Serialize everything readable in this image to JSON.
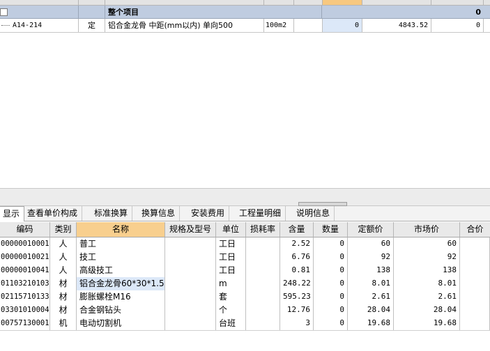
{
  "top_grid": {
    "total_row": {
      "name": "整个项目",
      "amount": "0"
    },
    "item_row": {
      "code": "A14-214",
      "type": "定",
      "name": "铝合金龙骨 中距(mm以内) 单向500",
      "unit": "100m2",
      "quantity": "0",
      "price": "4843.52",
      "total": "0"
    }
  },
  "tabs": [
    {
      "label": "显示"
    },
    {
      "label": "查看单价构成"
    },
    {
      "label": "标准换算"
    },
    {
      "label": "换算信息"
    },
    {
      "label": "安装费用"
    },
    {
      "label": "工程量明细"
    },
    {
      "label": "说明信息"
    }
  ],
  "bottom_grid": {
    "headers": [
      "编码",
      "类别",
      "名称",
      "规格及型号",
      "单位",
      "损耗率",
      "含量",
      "数量",
      "定额价",
      "市场价",
      "合价"
    ],
    "rows": [
      {
        "code": "00000010001",
        "type": "人",
        "name": "普工",
        "spec": "",
        "unit": "工日",
        "loss": "",
        "content": "2.52",
        "qty": "0",
        "quota_price": "60",
        "market_price": "60",
        "total": ""
      },
      {
        "code": "00000010021",
        "type": "人",
        "name": "技工",
        "spec": "",
        "unit": "工日",
        "loss": "",
        "content": "6.76",
        "qty": "0",
        "quota_price": "92",
        "market_price": "92",
        "total": ""
      },
      {
        "code": "00000010041",
        "type": "人",
        "name": "高级技工",
        "spec": "",
        "unit": "工日",
        "loss": "",
        "content": "0.81",
        "qty": "0",
        "quota_price": "138",
        "market_price": "138",
        "total": ""
      },
      {
        "code": "01103210103",
        "type": "材",
        "name": "铝合金龙骨60*30*1.5",
        "spec": "",
        "unit": "m",
        "loss": "",
        "content": "248.22",
        "qty": "0",
        "quota_price": "8.01",
        "market_price": "8.01",
        "total": ""
      },
      {
        "code": "02115710133",
        "type": "材",
        "name": "膨胀螺栓M16",
        "spec": "",
        "unit": "套",
        "loss": "",
        "content": "595.23",
        "qty": "0",
        "quota_price": "2.61",
        "market_price": "2.61",
        "total": ""
      },
      {
        "code": "03301010004",
        "type": "材",
        "name": "合金钢钻头",
        "spec": "",
        "unit": "个",
        "loss": "",
        "content": "12.76",
        "qty": "0",
        "quota_price": "28.04",
        "market_price": "28.04",
        "total": ""
      },
      {
        "code": "00757130001",
        "type": "机",
        "name": "电动切割机",
        "spec": "",
        "unit": "台班",
        "loss": "",
        "content": "3",
        "qty": "0",
        "quota_price": "19.68",
        "market_price": "19.68",
        "total": ""
      }
    ]
  },
  "colors": {
    "total_row_bg": "#bfcce0",
    "header_highlight": "#f8cf8e",
    "selected_cell": "#dce8f8"
  }
}
